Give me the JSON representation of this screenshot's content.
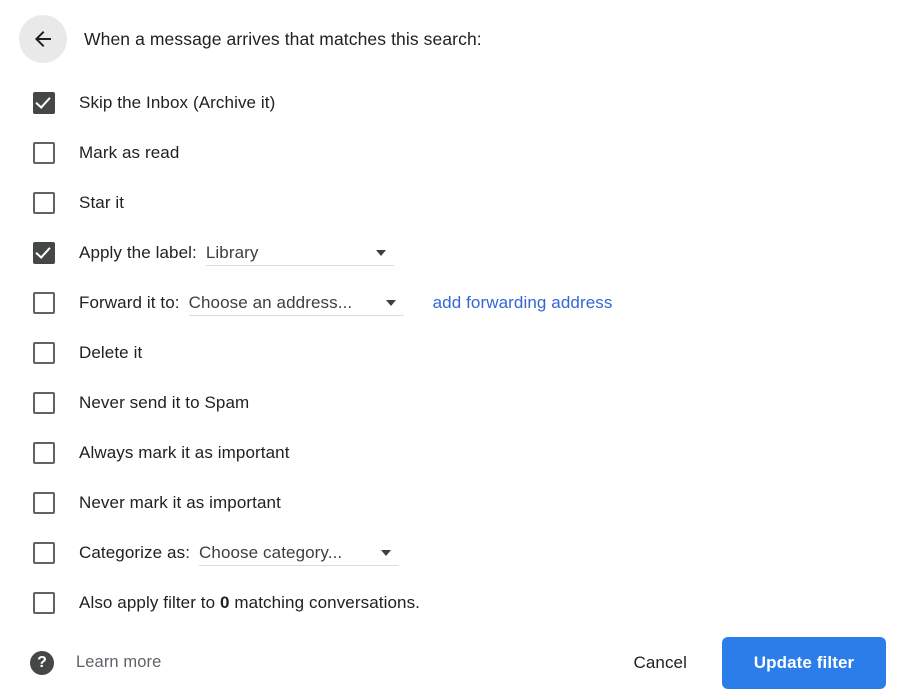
{
  "header": {
    "back_icon": "arrow-left-icon",
    "title": "When a message arrives that matches this search:"
  },
  "options": [
    {
      "label": "Skip the Inbox (Archive it)",
      "checked": true
    },
    {
      "label": "Mark as read",
      "checked": false
    },
    {
      "label": "Star it",
      "checked": false
    },
    {
      "label": "Apply the label:",
      "checked": true,
      "select": {
        "value": "Library",
        "name": "label-select"
      }
    },
    {
      "label": "Forward it to:",
      "checked": false,
      "select": {
        "value": "Choose an address...",
        "name": "forward-select"
      },
      "link": "add forwarding address"
    },
    {
      "label": "Delete it",
      "checked": false
    },
    {
      "label": "Never send it to Spam",
      "checked": false
    },
    {
      "label": "Always mark it as important",
      "checked": false
    },
    {
      "label": "Never mark it as important",
      "checked": false
    },
    {
      "label": "Categorize as:",
      "checked": false,
      "select": {
        "value": "Choose category...",
        "name": "category-select"
      }
    },
    {
      "label_pre": "Also apply filter to ",
      "label_bold": "0",
      "label_post": " matching conversations.",
      "checked": false
    }
  ],
  "footer": {
    "help_icon": "help-question-icon",
    "learn_more": "Learn more",
    "cancel_label": "Cancel",
    "update_label": "Update filter"
  },
  "colors": {
    "accent_blue": "#2b7de9",
    "link_blue": "#3367d6",
    "checkbox_fill": "#444746",
    "text": "#202124"
  }
}
